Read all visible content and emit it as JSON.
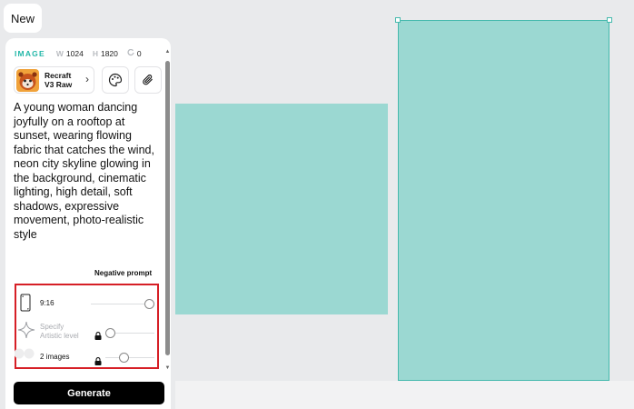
{
  "tab": {
    "label": "New"
  },
  "image_meta": {
    "label": "IMAGE",
    "width_key": "W",
    "width_value": "1024",
    "height_key": "H",
    "height_value": "1820",
    "seed_value": "0"
  },
  "model": {
    "line1": "Recraft",
    "line2": "V3 Raw"
  },
  "prompt": {
    "text": "A young woman dancing joyfully on a rooftop at sunset, wearing flowing fabric that catches the wind, neon city skyline glowing in the background, cinematic lighting, high detail, soft shadows, expressive movement, photo-realistic style"
  },
  "negative_prompt": {
    "label": "Negative prompt"
  },
  "settings": {
    "aspect_ratio": {
      "label": "9:16",
      "level": 1.0
    },
    "artistic_level": {
      "line1": "Specify",
      "line2": "Artistic level",
      "level": 0.0
    },
    "image_count": {
      "label": "2 images",
      "level": 0.5
    }
  },
  "generate": {
    "label": "Generate"
  },
  "colors": {
    "accent": "#22b7a8",
    "canvas_fill": "#9bd8d2",
    "highlight_border": "#d61f26",
    "button": "#000000"
  }
}
